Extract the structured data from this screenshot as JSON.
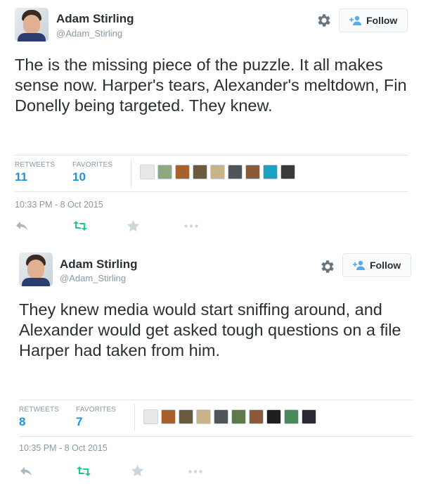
{
  "tweets": [
    {
      "author": {
        "name": "Adam Stirling",
        "handle": "@Adam_Stirling"
      },
      "follow_label": "Follow",
      "text": "The is the missing piece of the puzzle. It all makes sense now. Harper's tears, Alexander's meltdown, Fin Donelly being targeted. They knew.",
      "stats": {
        "retweets_label": "RETWEETS",
        "retweets": "11",
        "favorites_label": "FAVORITES",
        "favorites": "10"
      },
      "favoriters": [
        {
          "color": "#e8e8e8",
          "icon": "sketch-avatar"
        },
        {
          "color": "#8ea882",
          "icon": "photo-avatar"
        },
        {
          "color": "#a8612a",
          "icon": "dog-avatar"
        },
        {
          "color": "#6b5a3e",
          "icon": "statue-avatar"
        },
        {
          "color": "#c9b48a",
          "icon": "i-will-vote-badge-avatar"
        },
        {
          "color": "#50555a",
          "icon": "photo-avatar"
        },
        {
          "color": "#8a5a3a",
          "icon": "person-avatar"
        },
        {
          "color": "#1aa3c0",
          "icon": "photo-avatar"
        },
        {
          "color": "#3a3a3a",
          "icon": "bw-photo-avatar"
        }
      ],
      "timestamp": "10:33 PM - 8 Oct 2015"
    },
    {
      "author": {
        "name": "Adam Stirling",
        "handle": "@Adam_Stirling"
      },
      "follow_label": "Follow",
      "text": "They knew media would start sniffing around, and Alexander would get asked tough questions on a file Harper had taken from him.",
      "stats": {
        "retweets_label": "RETWEETS",
        "retweets": "8",
        "favorites_label": "FAVORITES",
        "favorites": "7"
      },
      "favoriters": [
        {
          "color": "#e8e8e8",
          "icon": "sketch-avatar"
        },
        {
          "color": "#a8612a",
          "icon": "dog-avatar"
        },
        {
          "color": "#6b5a3e",
          "icon": "statue-avatar"
        },
        {
          "color": "#c9b48a",
          "icon": "statue-avatar"
        },
        {
          "color": "#50555a",
          "icon": "photo-avatar"
        },
        {
          "color": "#5d7a4a",
          "icon": "photo-avatar"
        },
        {
          "color": "#8a5a3a",
          "icon": "person-avatar"
        },
        {
          "color": "#1e1e1e",
          "icon": "group-avatar"
        },
        {
          "color": "#4a8a5a",
          "icon": "person-avatar"
        },
        {
          "color": "#2a2a35",
          "icon": "person-avatar"
        }
      ],
      "timestamp": "10:35 PM - 8 Oct 2015"
    }
  ],
  "colors": {
    "link": "#1b95e0",
    "muted": "#8899a6",
    "retweet": "#19cf86",
    "follow_icon": "#55acee"
  }
}
